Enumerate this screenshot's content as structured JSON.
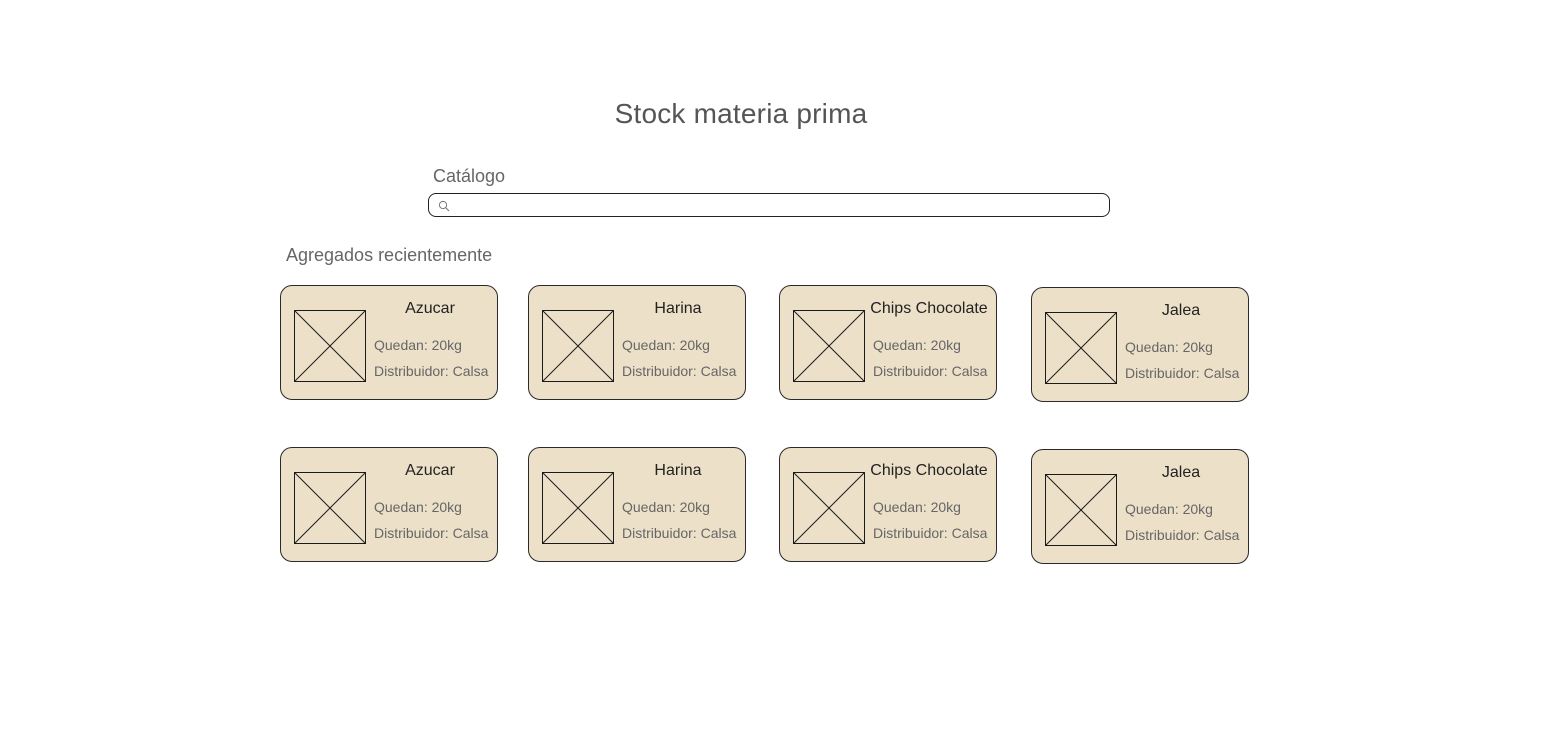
{
  "header": {
    "title": "Stock materia prima"
  },
  "catalog": {
    "label": "Catálogo",
    "search_value": "",
    "search_placeholder": ""
  },
  "recent": {
    "label": "Agregados recientemente",
    "rows": [
      [
        {
          "name": "Azucar",
          "quantity": "Quedan: 20kg",
          "distributor": "Distribuidor: Calsa"
        },
        {
          "name": "Harina",
          "quantity": "Quedan: 20kg",
          "distributor": "Distribuidor: Calsa"
        },
        {
          "name": "Chips Chocolate",
          "quantity": "Quedan: 20kg",
          "distributor": "Distribuidor: Calsa"
        },
        {
          "name": "Jalea",
          "quantity": "Quedan: 20kg",
          "distributor": "Distribuidor: Calsa"
        }
      ],
      [
        {
          "name": "Azucar",
          "quantity": "Quedan: 20kg",
          "distributor": "Distribuidor: Calsa"
        },
        {
          "name": "Harina",
          "quantity": "Quedan: 20kg",
          "distributor": "Distribuidor: Calsa"
        },
        {
          "name": "Chips Chocolate",
          "quantity": "Quedan: 20kg",
          "distributor": "Distribuidor: Calsa"
        },
        {
          "name": "Jalea",
          "quantity": "Quedan: 20kg",
          "distributor": "Distribuidor: Calsa"
        }
      ]
    ]
  },
  "icons": {
    "search": "search-icon",
    "image_placeholder": "image-placeholder-icon"
  },
  "colors": {
    "card_background": "#ede0c9",
    "card_border": "#2a2a2a",
    "title_text": "#555555"
  }
}
